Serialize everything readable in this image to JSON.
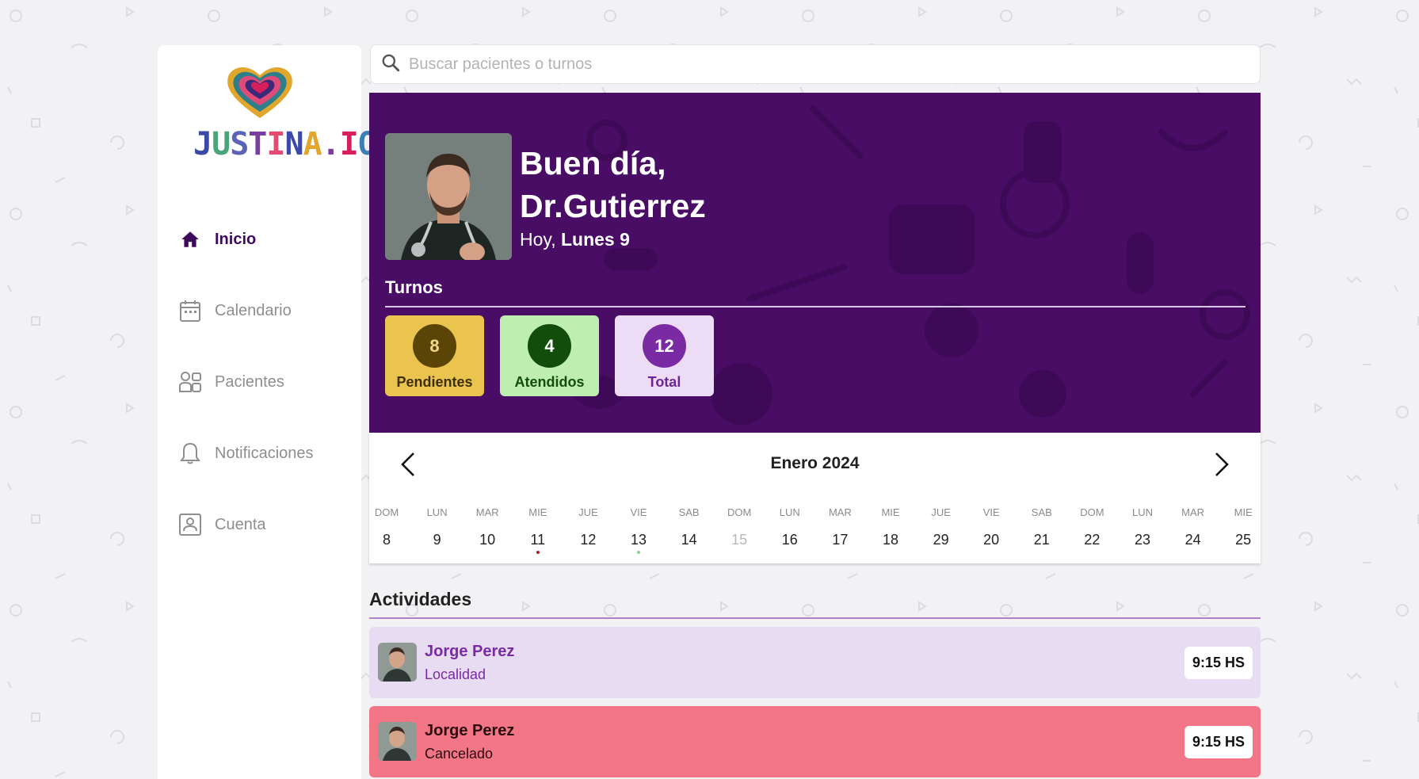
{
  "app": {
    "brand": "JUSTINA.IO"
  },
  "sidebar": {
    "items": [
      {
        "label": "Inicio",
        "icon": "home-icon",
        "active": true
      },
      {
        "label": "Calendario",
        "icon": "calendar-icon",
        "active": false
      },
      {
        "label": "Pacientes",
        "icon": "patients-icon",
        "active": false
      },
      {
        "label": "Notificaciones",
        "icon": "bell-icon",
        "active": false
      },
      {
        "label": "Cuenta",
        "icon": "account-icon",
        "active": false
      }
    ]
  },
  "search": {
    "placeholder": "Buscar pacientes o turnos"
  },
  "hero": {
    "greeting_line1": "Buen día,",
    "greeting_line2": "Dr.Gutierrez",
    "today_prefix": "Hoy,",
    "today_value": "Lunes 9",
    "turnos_title": "Turnos",
    "stats": [
      {
        "value": "8",
        "label": "Pendientes",
        "bg": "#ebc34f",
        "circle": "#5a4506",
        "circle_text": "#f1d88a",
        "text": "#3d2f05"
      },
      {
        "value": "4",
        "label": "Atendidos",
        "bg": "#bfeeb3",
        "circle": "#124d0c",
        "circle_text": "#ffffff",
        "text": "#124d0c"
      },
      {
        "value": "12",
        "label": "Total",
        "bg": "#ecdcf5",
        "circle": "#7a2aa3",
        "circle_text": "#ffffff",
        "text": "#6e2596"
      }
    ],
    "bg_color": "#4a0d66"
  },
  "calendar": {
    "month": "Enero 2024",
    "days": [
      {
        "name": "DOM",
        "num": "8"
      },
      {
        "name": "LUN",
        "num": "9"
      },
      {
        "name": "MAR",
        "num": "10"
      },
      {
        "name": "MIE",
        "num": "11",
        "dot": "#b01c2e"
      },
      {
        "name": "JUE",
        "num": "12"
      },
      {
        "name": "VIE",
        "num": "13",
        "dot": "#8bd68b"
      },
      {
        "name": "SAB",
        "num": "14"
      },
      {
        "name": "DOM",
        "num": "15",
        "muted": true
      },
      {
        "name": "LUN",
        "num": "16"
      },
      {
        "name": "MAR",
        "num": "17"
      },
      {
        "name": "MIE",
        "num": "18"
      },
      {
        "name": "JUE",
        "num": "29"
      },
      {
        "name": "VIE",
        "num": "20"
      },
      {
        "name": "SAB",
        "num": "21"
      },
      {
        "name": "DOM",
        "num": "22"
      },
      {
        "name": "LUN",
        "num": "23"
      },
      {
        "name": "MAR",
        "num": "24"
      },
      {
        "name": "MIE",
        "num": "25"
      }
    ]
  },
  "activities": {
    "title": "Actividades",
    "items": [
      {
        "name": "Jorge Perez",
        "status": "Localidad",
        "time": "9:15 HS",
        "bg": "#e8dcf3",
        "text": "#7a2aa3"
      },
      {
        "name": "Jorge Perez",
        "status": "Cancelado",
        "time": "9:15 HS",
        "bg": "#f27686",
        "text": "#2a0d10"
      }
    ]
  }
}
